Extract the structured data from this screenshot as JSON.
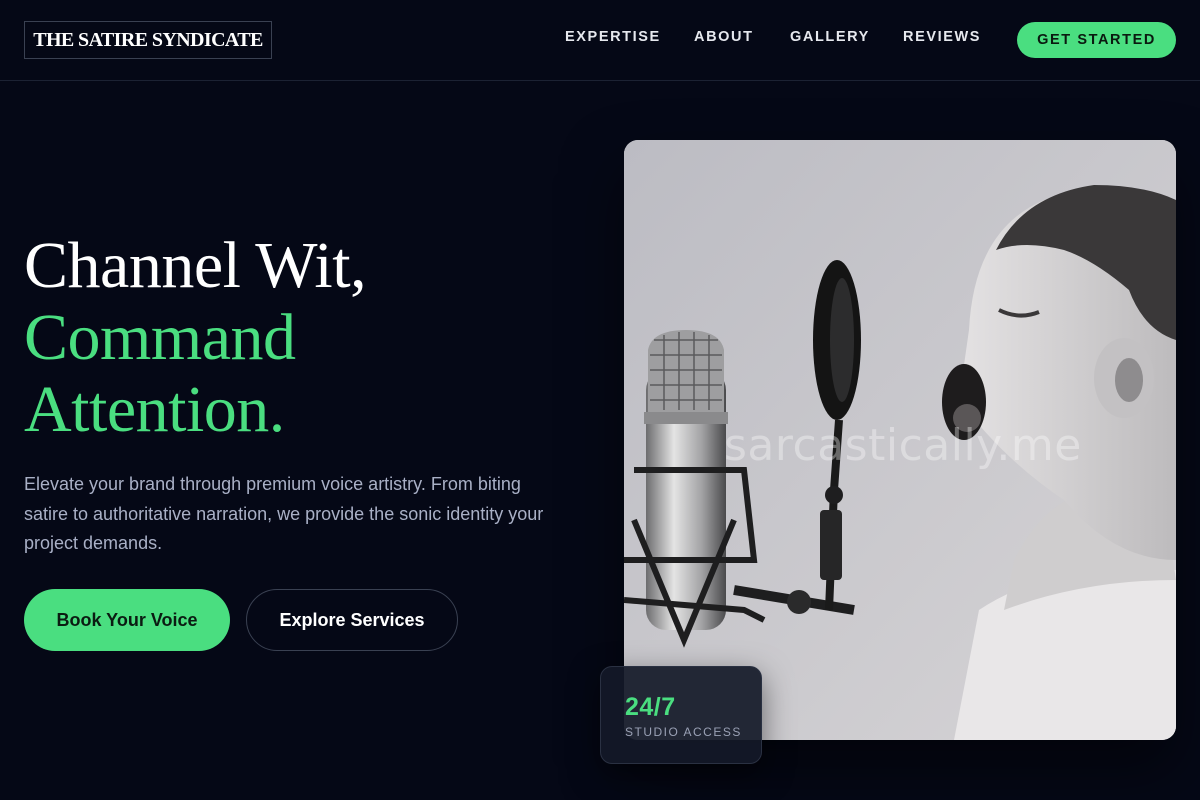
{
  "brand": {
    "name": "THE SATIRE SYNDICATE"
  },
  "nav": {
    "items": [
      {
        "label": "EXPERTISE"
      },
      {
        "label": "ABOUT"
      },
      {
        "label": "GALLERY"
      },
      {
        "label": "REVIEWS"
      }
    ],
    "cta_label": "GET STARTED"
  },
  "hero": {
    "headline_line1": "Channel Wit,",
    "headline_line2": "Command",
    "headline_line3": "Attention.",
    "subtitle": "Elevate your brand through premium voice artistry. From biting satire to authoritative narration, we provide the sonic identity your project demands.",
    "primary_button": "Book Your Voice",
    "secondary_button": "Explore Services",
    "image_watermark": "sarcastically.me"
  },
  "stat": {
    "value": "24/7",
    "label": "STUDIO ACCESS"
  },
  "colors": {
    "background": "#050816",
    "accent": "#4ade80",
    "muted_text": "#a9b0c6"
  }
}
